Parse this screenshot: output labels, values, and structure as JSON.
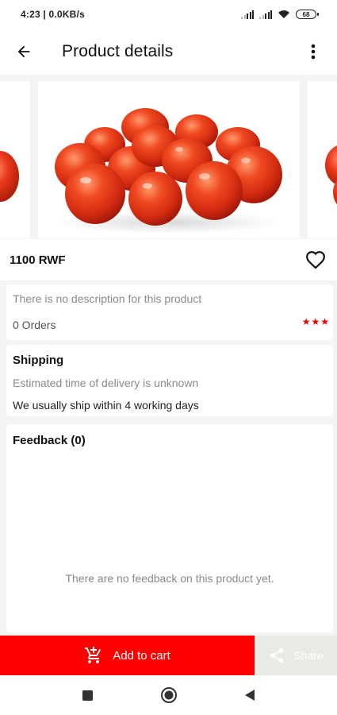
{
  "status": {
    "time_speed": "4:23 | 0.0KB/s",
    "battery": "68"
  },
  "header": {
    "title": "Product details",
    "back_icon": "arrow-left-icon",
    "menu_icon": "more-vert-icon"
  },
  "product": {
    "price": "1100 RWF",
    "image": "tomatoes-photo",
    "favorite_icon": "heart-outline-icon"
  },
  "description": {
    "text": "There is no description for this product",
    "orders": "0 Orders",
    "rating_stars": "★★★"
  },
  "shipping": {
    "title": "Shipping",
    "eta": "Estimated time of delivery is unknown",
    "note": "We usually ship within 4 working days"
  },
  "feedback": {
    "title": "Feedback (0)",
    "empty": "There are no feedback on this product yet."
  },
  "actions": {
    "add_to_cart": "Add to cart",
    "share": "Share"
  },
  "colors": {
    "accent": "#ff0000",
    "share_bg": "#e8eae5",
    "stars": "#e60000"
  }
}
